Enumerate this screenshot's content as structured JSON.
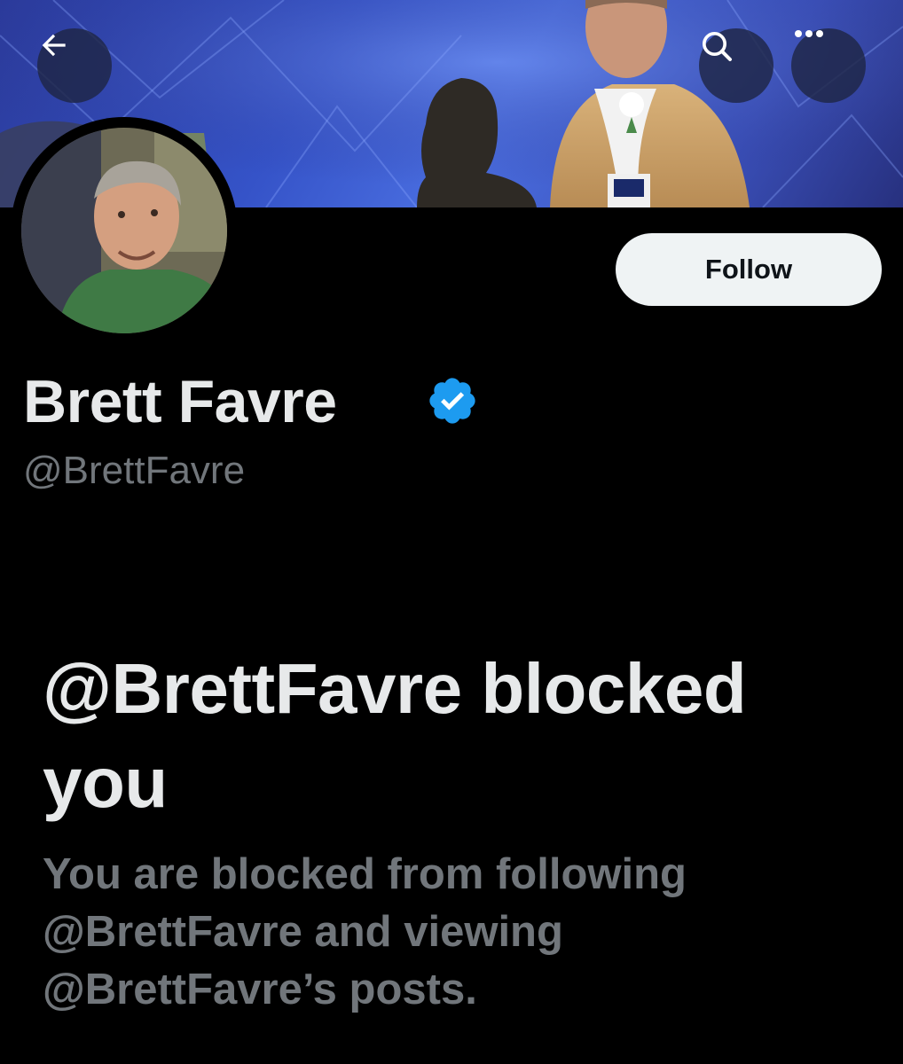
{
  "header": {
    "back_icon": "arrow-left-icon",
    "search_icon": "search-icon",
    "more_icon": "more-horizontal-icon",
    "more_glyph": "•••"
  },
  "profile": {
    "display_name": "Brett Favre",
    "handle": "@BrettFavre",
    "verified": true,
    "verified_color": "#1d9bf0",
    "follow_label": "Follow"
  },
  "blocked": {
    "title": "@BrettFavre blocked you",
    "description": "You are blocked from following @BrettFavre and viewing @BrettFavre’s posts."
  },
  "colors": {
    "background": "#000000",
    "primary_text": "#e7e9ea",
    "secondary_text": "#71767b",
    "button_bg": "#eff3f4"
  }
}
